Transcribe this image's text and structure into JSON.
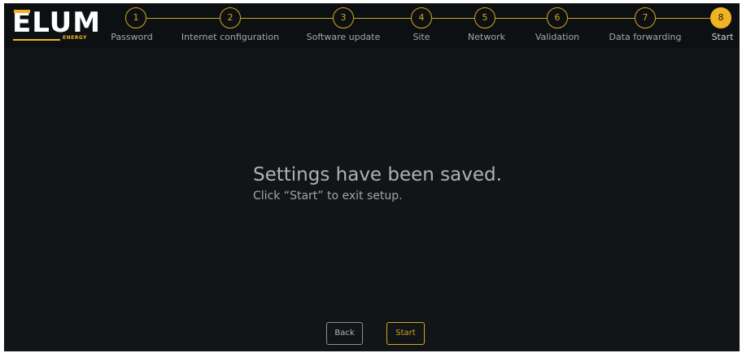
{
  "logo": {
    "text": "ELUM",
    "subtitle": "ENERGY"
  },
  "steps": [
    {
      "number": "1",
      "label": "Password"
    },
    {
      "number": "2",
      "label": "Internet configuration"
    },
    {
      "number": "3",
      "label": "Software update"
    },
    {
      "number": "4",
      "label": "Site"
    },
    {
      "number": "5",
      "label": "Network"
    },
    {
      "number": "6",
      "label": "Validation"
    },
    {
      "number": "7",
      "label": "Data forwarding"
    },
    {
      "number": "8",
      "label": "Start"
    }
  ],
  "current_step": 8,
  "message": {
    "title": "Settings have been saved.",
    "subtitle": "Click “Start” to exit setup."
  },
  "buttons": {
    "back_label": "Back",
    "start_label": "Start"
  },
  "colors": {
    "accent": "#f0b323",
    "background": "#111517",
    "text": "#aeb2b6"
  }
}
